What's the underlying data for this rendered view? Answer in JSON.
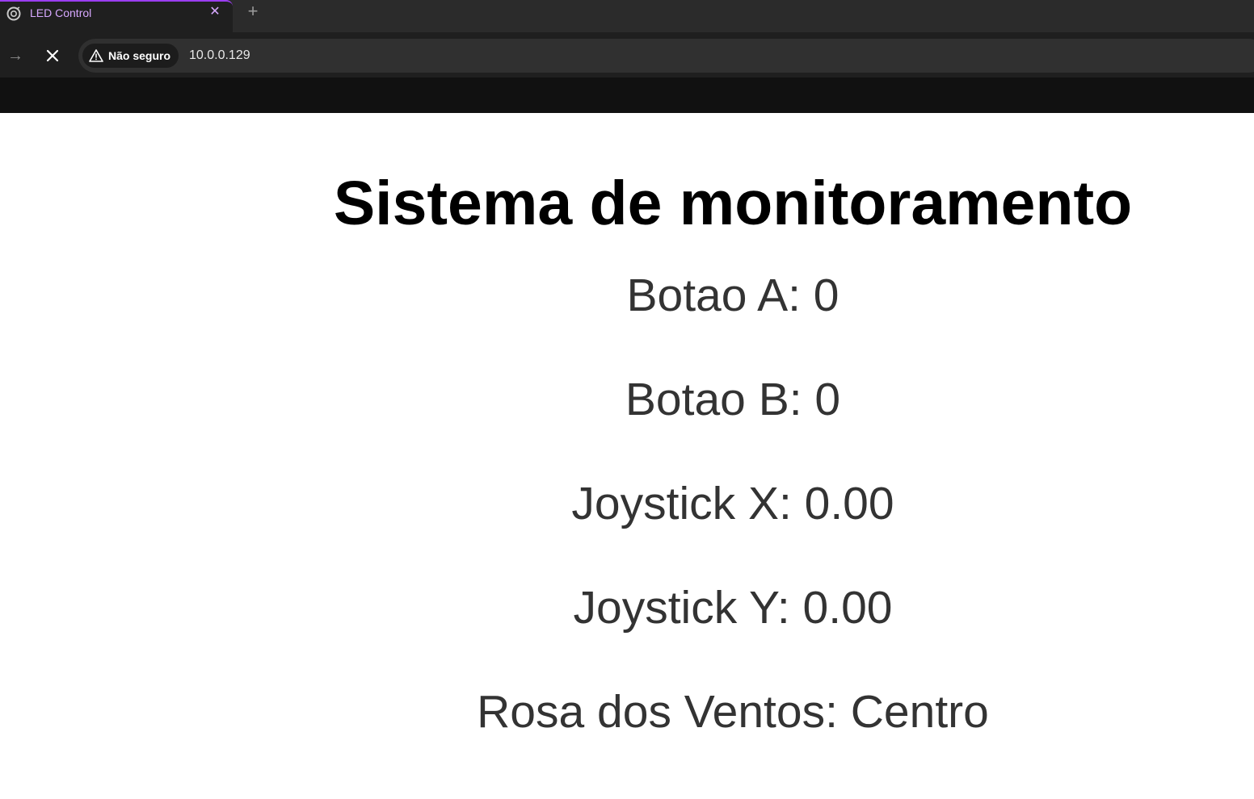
{
  "browser": {
    "tab": {
      "title": "LED Control",
      "close_glyph": "✕",
      "favicon": "loading-favicon-icon"
    },
    "new_tab_glyph": "+",
    "nav": {
      "forward_glyph": "→",
      "stop_icon": "close-icon"
    },
    "omnibox": {
      "security_label": "Não seguro",
      "security_icon": "warning-triangle-icon",
      "url": "10.0.0.129"
    },
    "colors": {
      "accent": "#9b3df0",
      "tab_text": "#d7a8ff"
    }
  },
  "page": {
    "title": "Sistema de monitoramento",
    "readings": [
      {
        "label": "Botao A",
        "value": "0",
        "text": "Botao A: 0"
      },
      {
        "label": "Botao B",
        "value": "0",
        "text": "Botao B: 0"
      },
      {
        "label": "Joystick X",
        "value": "0.00",
        "text": "Joystick X: 0.00"
      },
      {
        "label": "Joystick Y",
        "value": "0.00",
        "text": "Joystick Y: 0.00"
      },
      {
        "label": "Rosa dos Ventos",
        "value": "Centro",
        "text": "Rosa dos Ventos: Centro"
      }
    ]
  }
}
